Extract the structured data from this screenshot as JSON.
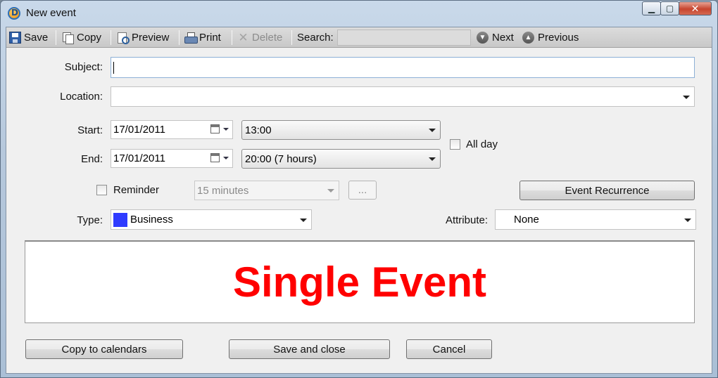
{
  "window": {
    "title": "New event"
  },
  "toolbar": {
    "save": "Save",
    "copy": "Copy",
    "preview": "Preview",
    "print": "Print",
    "delete": "Delete",
    "search_label": "Search:",
    "search_value": "",
    "next": "Next",
    "previous": "Previous"
  },
  "form": {
    "subject_label": "Subject:",
    "subject_value": "",
    "location_label": "Location:",
    "location_value": "",
    "start_label": "Start:",
    "start_date": "17/01/2011",
    "start_time": "13:00",
    "end_label": "End:",
    "end_date": "17/01/2011",
    "end_time": "20:00 (7 hours)",
    "all_day_label": "All day",
    "all_day_checked": false,
    "reminder_label": "Reminder",
    "reminder_checked": false,
    "reminder_value": "15 minutes",
    "reminder_more": "...",
    "recurrence_button": "Event Recurrence",
    "type_label": "Type:",
    "type_value": "Business",
    "type_color": "#2f3bff",
    "attribute_label": "Attribute:",
    "attribute_value": "None"
  },
  "banner": {
    "text": "Single Event",
    "color": "#ff0000"
  },
  "footer": {
    "copy_to_calendars": "Copy to calendars",
    "save_and_close": "Save and close",
    "cancel": "Cancel"
  }
}
